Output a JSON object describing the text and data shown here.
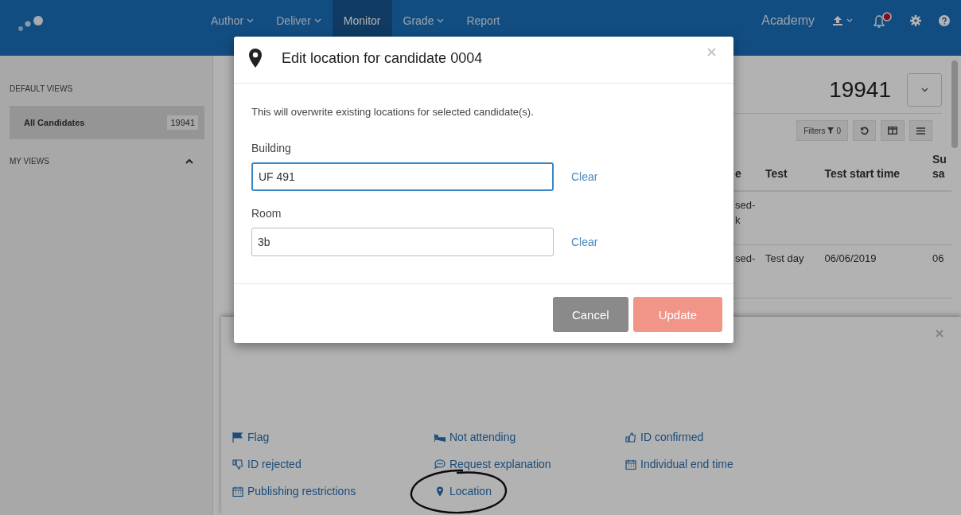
{
  "nav": {
    "items": [
      {
        "label": "Author",
        "caret": true,
        "selected": false
      },
      {
        "label": "Deliver",
        "caret": true,
        "selected": false
      },
      {
        "label": "Monitor",
        "caret": false,
        "selected": true
      },
      {
        "label": "Grade",
        "caret": true,
        "selected": false
      },
      {
        "label": "Report",
        "caret": false,
        "selected": false
      }
    ],
    "academy": "Academy",
    "notifications": {
      "unread": true
    }
  },
  "sidebar": {
    "default_views": {
      "title": "DEFAULT VIEWS",
      "items": [
        {
          "label": "All Candidates",
          "count": "19941",
          "selected": true
        }
      ]
    },
    "my_views": {
      "title": "MY VIEWS",
      "expanded": true
    }
  },
  "main": {
    "total": "19941",
    "filters": {
      "label": "Filters",
      "count": "0"
    },
    "table": {
      "columns": [
        "e",
        "Test",
        "Test start time",
        "Su sa"
      ],
      "rows": [
        [
          "sed- k",
          "",
          "",
          ""
        ],
        [
          "sed-",
          "Test day",
          "06/06/2019",
          "06"
        ]
      ]
    }
  },
  "actions_panel": {
    "items": [
      {
        "kind": "flag",
        "label": "Flag",
        "circled": false
      },
      {
        "kind": "not-attending",
        "label": "Not attending",
        "circled": false
      },
      {
        "kind": "id-confirmed",
        "label": "ID confirmed",
        "circled": false
      },
      {
        "kind": "id-rejected",
        "label": "ID rejected",
        "circled": false
      },
      {
        "kind": "request-explanation",
        "label": "Request explanation",
        "circled": false
      },
      {
        "kind": "calendar",
        "label": "Individual end time",
        "circled": false
      },
      {
        "kind": "calendar",
        "label": "Publishing restrictions",
        "circled": false
      },
      {
        "kind": "location",
        "label": "Location",
        "circled": true
      }
    ]
  },
  "modal": {
    "title": "Edit location for candidate 0004",
    "message": "This will overwrite existing locations for selected candidate(s).",
    "fields": [
      {
        "label": "Building",
        "value": "UF 491",
        "focused": true,
        "clear": "Clear"
      },
      {
        "label": "Room",
        "value": "3b",
        "focused": false,
        "clear": "Clear"
      }
    ],
    "buttons": [
      {
        "kind": "cancel",
        "label": "Cancel",
        "disabled": false
      },
      {
        "kind": "primary",
        "label": "Update",
        "disabled": true
      }
    ]
  }
}
